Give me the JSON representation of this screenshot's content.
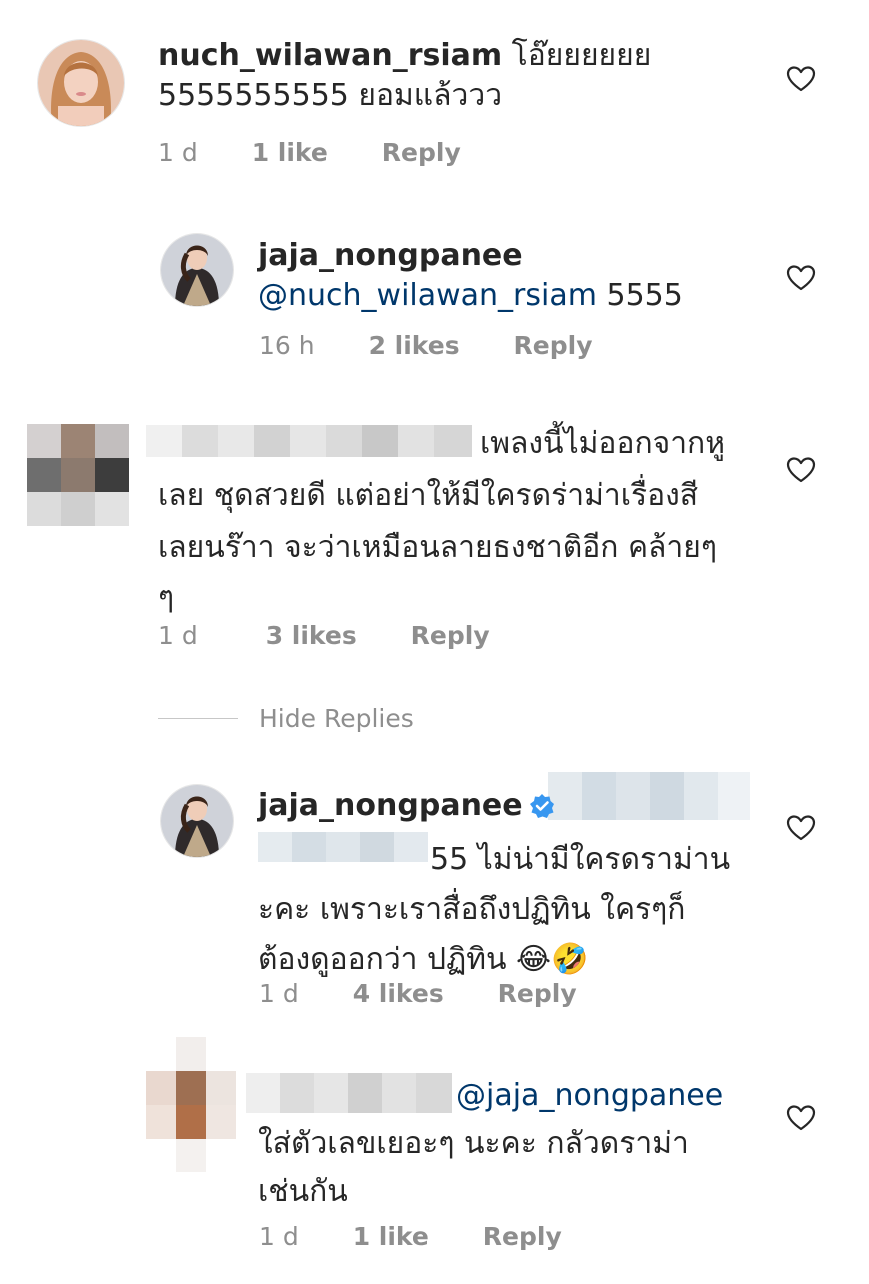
{
  "comments": [
    {
      "username": "nuch_wilawan_rsiam",
      "text_line1": " โอ๊ยยยยยย",
      "text_line2": "5555555555 ยอมแล้ววว",
      "time": "1 d",
      "likes": "1 like",
      "reply": "Reply"
    },
    {
      "username": "jaja_nongpanee",
      "mention": "@nuch_wilawan_rsiam",
      "text": " 5555",
      "time": "16 h",
      "likes": "2 likes",
      "reply": "Reply"
    },
    {
      "text_line1": "เพลงนี้ไม่ออกจากหู",
      "text_line2": "เลย ชุดสวยดี แต่อย่าให้มีใครดร่าม่าเรื่องสี",
      "text_line3": "เลยนร๊าา จะว่าเหมือนลายธงชาติอีก คล้ายๆ",
      "text_line4": "ๆ",
      "time": "1 d",
      "likes": "3 likes",
      "reply": "Reply"
    },
    {
      "username": "jaja_nongpanee",
      "text_line1": "55 ไม่น่ามีใครดราม่าน",
      "text_line2": "ะคะ เพราะเราสื่อถึงปฏิทิน ใครๆก็",
      "text_line3": "ต้องดูออกว่า ปฏิทิน 😂🤣",
      "time": "1 d",
      "likes": "4 likes",
      "reply": "Reply"
    },
    {
      "mention": "@jaja_nongpanee",
      "text_line1": "ใส่ตัวเลขเยอะๆ นะคะ กลัวดราม่า",
      "text_line2": "เช่นกัน",
      "time": "1 d",
      "likes": "1 like",
      "reply": "Reply"
    }
  ],
  "hide_replies": "Hide Replies",
  "icons": {
    "like": "heart-outline-icon",
    "verified": "verified-badge-icon"
  },
  "colors": {
    "text": "#262626",
    "meta": "#8e8e8e",
    "mention": "#00376b",
    "verified": "#3897f0"
  }
}
